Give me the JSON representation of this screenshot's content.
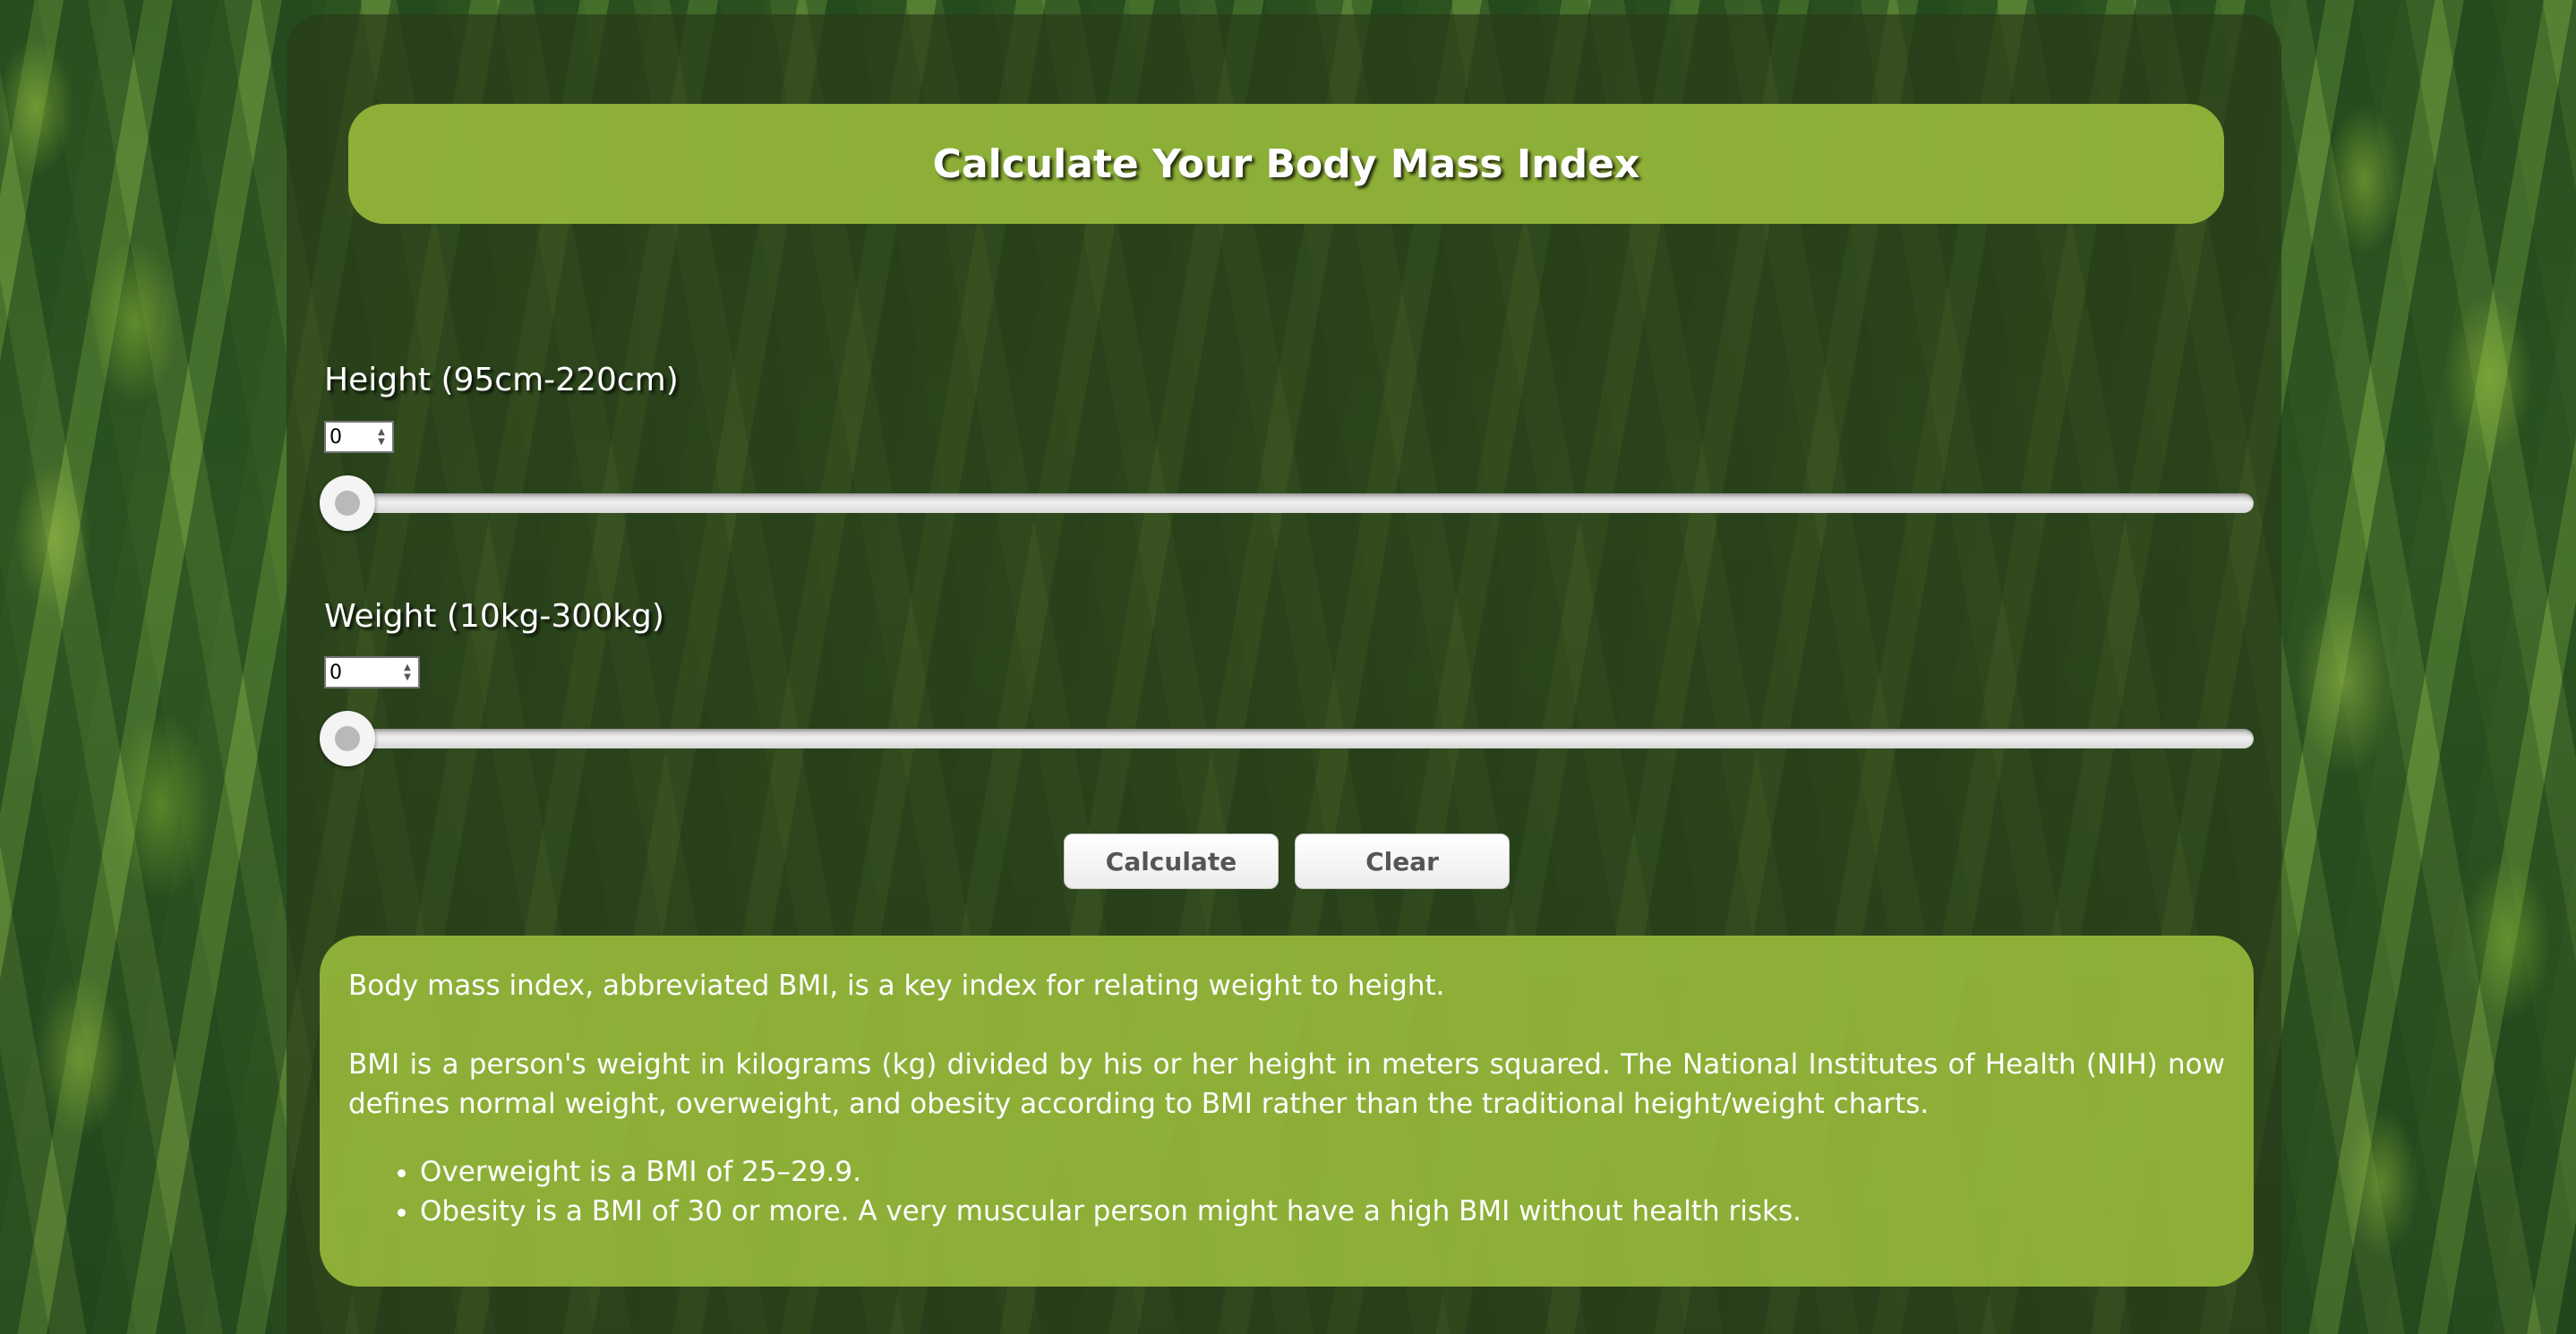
{
  "header": {
    "title": "Calculate Your Body Mass Index"
  },
  "height_field": {
    "label": "Height (95cm-220cm)",
    "value": "0",
    "slider_value_cm": 0
  },
  "weight_field": {
    "label": "Weight (10kg-300kg)",
    "value": "0",
    "slider_value_kg": 0
  },
  "buttons": {
    "calculate_label": "Calculate",
    "clear_label": "Clear"
  },
  "info": {
    "paragraph_1": "Body mass index, abbreviated BMI, is a key index for relating weight to height.",
    "paragraph_2": "BMI is a person's weight in kilograms (kg) divided by his or her height in meters squared. The National Institutes of Health (NIH) now defines normal weight, overweight, and obesity according to BMI rather than the traditional height/weight charts.",
    "bullets": [
      "Overweight is a BMI of 25–29.9.",
      "Obesity is a BMI of 30 or more. A very muscular person might have a high BMI without health risks."
    ]
  },
  "colors": {
    "panel_green": "#9bbe3c",
    "panel_dark": "#283c19",
    "text": "#ffffff",
    "button_text": "#555555"
  },
  "icons": {
    "bullet": "disc-bullet-icon",
    "spinner": "spinner-arrows-icon"
  }
}
